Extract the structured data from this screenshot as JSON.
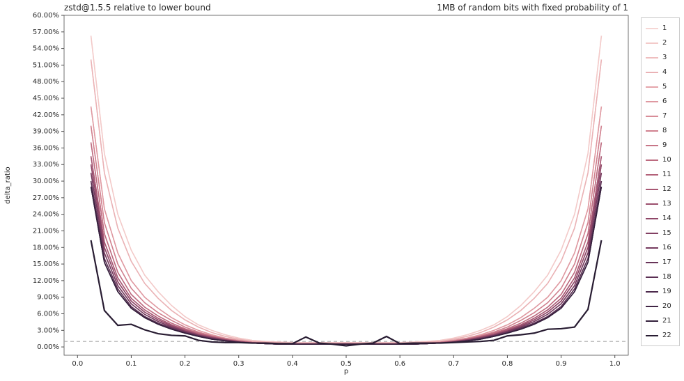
{
  "chart_data": {
    "type": "line",
    "title_left": "zstd@1.5.5 relative to lower bound",
    "title_right": "1MB of random bits with fixed probability of 1",
    "xlabel": "p",
    "ylabel": "delta_ratio",
    "xlim": [
      -0.025,
      1.025
    ],
    "ylim": [
      -1.5,
      60.0
    ],
    "xticks": [
      0.0,
      0.1,
      0.2,
      0.3,
      0.4,
      0.5,
      0.6,
      0.7,
      0.8,
      0.9,
      1.0
    ],
    "xticklabels": [
      "0.0",
      "0.1",
      "0.2",
      "0.3",
      "0.4",
      "0.5",
      "0.6",
      "0.7",
      "0.8",
      "0.9",
      "1.0"
    ],
    "yticks": [
      0,
      3,
      6,
      9,
      12,
      15,
      18,
      21,
      24,
      27,
      30,
      33,
      36,
      39,
      42,
      45,
      48,
      51,
      54,
      57,
      60
    ],
    "yticklabels": [
      "0.00%",
      "3.00%",
      "6.00%",
      "9.00%",
      "12.00%",
      "15.00%",
      "18.00%",
      "21.00%",
      "24.00%",
      "27.00%",
      "30.00%",
      "33.00%",
      "36.00%",
      "39.00%",
      "42.00%",
      "45.00%",
      "48.00%",
      "51.00%",
      "54.00%",
      "57.00%",
      "60.00%"
    ],
    "baseline_y": 1.0,
    "x": [
      0.025,
      0.05,
      0.075,
      0.1,
      0.125,
      0.15,
      0.175,
      0.2,
      0.225,
      0.25,
      0.275,
      0.3,
      0.325,
      0.35,
      0.375,
      0.4,
      0.425,
      0.45,
      0.475,
      0.5,
      0.525,
      0.55,
      0.575,
      0.6,
      0.625,
      0.65,
      0.675,
      0.7,
      0.725,
      0.75,
      0.775,
      0.8,
      0.825,
      0.85,
      0.875,
      0.9,
      0.925,
      0.95,
      0.975
    ],
    "legend_labels": [
      "1",
      "2",
      "3",
      "4",
      "5",
      "6",
      "7",
      "8",
      "9",
      "10",
      "11",
      "12",
      "13",
      "14",
      "15",
      "16",
      "17",
      "18",
      "19",
      "20",
      "21",
      "22"
    ],
    "colors": [
      "#f6d6d4",
      "#f3cac9",
      "#efbebf",
      "#eab2b5",
      "#e5a5ab",
      "#df99a1",
      "#d88d98",
      "#d0818f",
      "#c77687",
      "#bd6b80",
      "#b36179",
      "#a75773",
      "#9b4f6d",
      "#8f4768",
      "#824063",
      "#753a5e",
      "#683459",
      "#5a2f53",
      "#4d2a4d",
      "#402545",
      "#34203c",
      "#281c32"
    ],
    "series": [
      {
        "name": "1",
        "values": [
          56.3,
          35.0,
          24.0,
          17.5,
          13.0,
          10.0,
          7.5,
          5.5,
          4.0,
          3.0,
          2.2,
          1.6,
          1.2,
          1.0,
          0.9,
          0.8,
          0.8,
          0.8,
          0.8,
          0.8,
          0.8,
          0.8,
          0.8,
          0.8,
          0.9,
          1.0,
          1.2,
          1.6,
          2.2,
          3.0,
          4.0,
          5.5,
          7.5,
          10.0,
          13.0,
          17.5,
          24.0,
          35.0,
          56.3
        ]
      },
      {
        "name": "2",
        "values": [
          56.3,
          35.0,
          24.0,
          17.5,
          13.0,
          10.0,
          7.5,
          5.5,
          4.0,
          3.0,
          2.2,
          1.6,
          1.2,
          1.0,
          0.9,
          0.8,
          0.8,
          0.8,
          0.8,
          0.8,
          0.8,
          0.8,
          0.8,
          0.8,
          0.9,
          1.0,
          1.2,
          1.6,
          2.2,
          3.0,
          4.0,
          5.5,
          7.5,
          10.0,
          13.0,
          17.5,
          24.0,
          35.0,
          56.3
        ]
      },
      {
        "name": "3",
        "values": [
          52.0,
          31.5,
          21.5,
          15.5,
          11.5,
          8.8,
          6.6,
          4.9,
          3.6,
          2.6,
          1.9,
          1.4,
          1.0,
          0.9,
          0.8,
          0.7,
          0.7,
          0.7,
          0.7,
          0.7,
          0.7,
          0.7,
          0.7,
          0.7,
          0.8,
          0.9,
          1.0,
          1.4,
          1.9,
          2.6,
          3.6,
          4.9,
          6.6,
          8.8,
          11.5,
          15.5,
          21.5,
          31.5,
          52.0
        ]
      },
      {
        "name": "4",
        "values": [
          52.0,
          31.5,
          21.5,
          15.5,
          11.5,
          8.8,
          6.6,
          4.9,
          3.6,
          2.6,
          1.9,
          1.4,
          1.0,
          0.9,
          0.8,
          0.7,
          0.7,
          0.7,
          0.7,
          0.7,
          0.7,
          0.7,
          0.7,
          0.7,
          0.8,
          0.9,
          1.0,
          1.4,
          1.9,
          2.6,
          3.6,
          4.9,
          6.6,
          8.8,
          11.5,
          15.5,
          21.5,
          31.5,
          52.0
        ]
      },
      {
        "name": "5",
        "values": [
          43.5,
          25.0,
          17.0,
          12.0,
          9.0,
          7.0,
          5.3,
          4.0,
          3.0,
          2.2,
          1.6,
          1.2,
          0.9,
          0.8,
          0.7,
          0.6,
          0.6,
          0.6,
          0.6,
          0.6,
          0.6,
          0.6,
          0.6,
          0.6,
          0.7,
          0.8,
          0.9,
          1.2,
          1.6,
          2.2,
          3.0,
          4.0,
          5.3,
          7.0,
          9.0,
          12.0,
          17.0,
          25.0,
          43.5
        ]
      },
      {
        "name": "6",
        "values": [
          43.5,
          25.0,
          17.0,
          12.0,
          9.0,
          7.0,
          5.3,
          4.0,
          3.0,
          2.2,
          1.6,
          1.2,
          0.9,
          0.8,
          0.7,
          0.6,
          0.6,
          0.6,
          0.6,
          0.6,
          0.6,
          0.6,
          0.6,
          0.6,
          0.7,
          0.8,
          0.9,
          1.2,
          1.6,
          2.2,
          3.0,
          4.0,
          5.3,
          7.0,
          9.0,
          12.0,
          17.0,
          25.0,
          43.5
        ]
      },
      {
        "name": "7",
        "values": [
          40.0,
          22.5,
          15.0,
          10.6,
          8.0,
          6.2,
          4.8,
          3.6,
          2.7,
          2.0,
          1.5,
          1.1,
          0.8,
          0.7,
          0.6,
          0.6,
          0.6,
          0.6,
          0.6,
          0.6,
          0.6,
          0.6,
          0.6,
          0.6,
          0.6,
          0.7,
          0.8,
          1.1,
          1.5,
          2.0,
          2.7,
          3.6,
          4.8,
          6.2,
          8.0,
          10.6,
          15.0,
          22.5,
          40.0
        ]
      },
      {
        "name": "8",
        "values": [
          40.0,
          22.5,
          15.0,
          10.6,
          8.0,
          6.2,
          4.8,
          3.6,
          2.7,
          2.0,
          1.5,
          1.1,
          0.8,
          0.7,
          0.6,
          0.6,
          0.6,
          0.6,
          0.6,
          0.6,
          0.6,
          0.6,
          0.6,
          0.6,
          0.6,
          0.7,
          0.8,
          1.1,
          1.5,
          2.0,
          2.7,
          3.6,
          4.8,
          6.2,
          8.0,
          10.6,
          15.0,
          22.5,
          40.0
        ]
      },
      {
        "name": "9",
        "values": [
          37.0,
          20.5,
          13.5,
          9.5,
          7.2,
          5.6,
          4.3,
          3.3,
          2.5,
          1.9,
          1.4,
          1.0,
          0.8,
          0.7,
          0.6,
          0.6,
          0.6,
          0.6,
          0.6,
          0.6,
          0.6,
          0.6,
          0.6,
          0.6,
          0.6,
          0.7,
          0.8,
          1.0,
          1.4,
          1.9,
          2.5,
          3.3,
          4.3,
          5.6,
          7.2,
          9.5,
          13.5,
          20.5,
          37.0
        ]
      },
      {
        "name": "10",
        "values": [
          37.0,
          20.5,
          13.5,
          9.5,
          7.2,
          5.6,
          4.3,
          3.3,
          2.5,
          1.9,
          1.4,
          1.0,
          0.8,
          0.7,
          0.6,
          0.6,
          0.6,
          0.6,
          0.6,
          0.6,
          0.6,
          0.6,
          0.6,
          0.6,
          0.6,
          0.7,
          0.8,
          1.0,
          1.4,
          1.9,
          2.5,
          3.3,
          4.3,
          5.6,
          7.2,
          9.5,
          13.5,
          20.5,
          37.0
        ]
      },
      {
        "name": "11",
        "values": [
          34.5,
          19.0,
          12.5,
          8.8,
          6.7,
          5.2,
          4.0,
          3.1,
          2.3,
          1.8,
          1.3,
          1.0,
          0.8,
          0.6,
          0.6,
          0.5,
          0.5,
          0.5,
          0.5,
          0.5,
          0.5,
          0.5,
          0.5,
          0.5,
          0.6,
          0.6,
          0.8,
          1.0,
          1.3,
          1.8,
          2.3,
          3.1,
          4.0,
          5.2,
          6.7,
          8.8,
          12.5,
          19.0,
          34.5
        ]
      },
      {
        "name": "12",
        "values": [
          34.5,
          19.0,
          12.5,
          8.8,
          6.7,
          5.2,
          4.0,
          3.1,
          2.3,
          1.8,
          1.3,
          1.0,
          0.8,
          0.6,
          0.6,
          0.5,
          0.5,
          0.5,
          0.5,
          0.5,
          0.5,
          0.5,
          0.5,
          0.5,
          0.6,
          0.6,
          0.8,
          1.0,
          1.3,
          1.8,
          2.3,
          3.1,
          4.0,
          5.2,
          6.7,
          8.8,
          12.5,
          19.0,
          34.5
        ]
      },
      {
        "name": "13",
        "values": [
          33.0,
          18.0,
          11.8,
          8.3,
          6.3,
          4.9,
          3.8,
          2.9,
          2.2,
          1.7,
          1.3,
          0.9,
          0.7,
          0.6,
          0.6,
          0.5,
          0.5,
          0.5,
          0.5,
          0.5,
          0.5,
          0.5,
          0.5,
          0.5,
          0.6,
          0.6,
          0.7,
          0.9,
          1.3,
          1.7,
          2.2,
          2.9,
          3.8,
          4.9,
          6.3,
          8.3,
          11.8,
          18.0,
          33.0
        ]
      },
      {
        "name": "14",
        "values": [
          33.0,
          18.0,
          11.8,
          8.3,
          6.3,
          4.9,
          3.8,
          2.9,
          2.2,
          1.7,
          1.3,
          0.9,
          0.7,
          0.6,
          0.6,
          0.5,
          0.5,
          0.5,
          0.5,
          0.5,
          0.5,
          0.5,
          0.5,
          0.5,
          0.6,
          0.6,
          0.7,
          0.9,
          1.3,
          1.7,
          2.2,
          2.9,
          3.8,
          4.9,
          6.3,
          8.3,
          11.8,
          18.0,
          33.0
        ]
      },
      {
        "name": "15",
        "values": [
          31.5,
          17.0,
          11.1,
          7.8,
          5.9,
          4.6,
          3.6,
          2.8,
          2.1,
          1.6,
          1.2,
          0.9,
          0.7,
          0.6,
          0.5,
          0.5,
          0.5,
          0.5,
          0.5,
          0.5,
          0.5,
          0.5,
          0.5,
          0.5,
          0.5,
          0.6,
          0.7,
          0.9,
          1.2,
          1.6,
          2.1,
          2.8,
          3.6,
          4.6,
          5.9,
          7.8,
          11.1,
          17.0,
          31.5
        ]
      },
      {
        "name": "16",
        "values": [
          31.5,
          17.0,
          11.1,
          7.8,
          5.9,
          4.6,
          3.6,
          2.8,
          2.1,
          1.6,
          1.2,
          0.9,
          0.7,
          0.6,
          0.5,
          0.5,
          0.5,
          0.5,
          0.5,
          0.5,
          0.5,
          0.5,
          0.5,
          0.5,
          0.5,
          0.6,
          0.7,
          0.9,
          1.2,
          1.6,
          2.1,
          2.8,
          3.6,
          4.6,
          5.9,
          7.8,
          11.1,
          17.0,
          31.5
        ]
      },
      {
        "name": "17",
        "values": [
          30.0,
          16.0,
          10.5,
          7.3,
          5.5,
          4.3,
          3.4,
          2.6,
          2.0,
          1.5,
          1.1,
          0.9,
          0.7,
          0.6,
          0.5,
          0.5,
          0.5,
          0.5,
          0.5,
          0.5,
          0.5,
          0.5,
          0.5,
          0.5,
          0.5,
          0.6,
          0.7,
          0.9,
          1.1,
          1.5,
          2.0,
          2.6,
          3.4,
          4.3,
          5.5,
          7.3,
          10.5,
          16.0,
          30.0
        ]
      },
      {
        "name": "18",
        "values": [
          30.0,
          16.0,
          10.5,
          7.3,
          5.5,
          4.3,
          3.4,
          2.6,
          2.0,
          1.5,
          1.1,
          0.9,
          0.7,
          0.6,
          0.5,
          0.5,
          0.5,
          0.5,
          0.5,
          0.5,
          0.5,
          0.5,
          0.5,
          0.5,
          0.5,
          0.6,
          0.7,
          0.9,
          1.1,
          1.5,
          2.0,
          2.6,
          3.4,
          4.3,
          5.5,
          7.3,
          10.5,
          16.0,
          30.0
        ]
      },
      {
        "name": "19",
        "values": [
          29.0,
          15.3,
          10.0,
          7.0,
          5.3,
          4.1,
          3.2,
          2.5,
          1.9,
          1.4,
          1.1,
          0.8,
          0.7,
          0.6,
          0.5,
          0.5,
          0.5,
          0.5,
          0.5,
          0.5,
          0.5,
          0.5,
          0.5,
          0.5,
          0.5,
          0.6,
          0.7,
          0.8,
          1.1,
          1.4,
          1.9,
          2.5,
          3.2,
          4.1,
          5.3,
          7.0,
          10.0,
          15.3,
          29.0
        ]
      },
      {
        "name": "20",
        "values": [
          29.0,
          15.3,
          10.0,
          7.0,
          5.3,
          4.1,
          3.2,
          2.5,
          1.9,
          1.4,
          1.1,
          0.8,
          0.7,
          0.6,
          0.5,
          0.5,
          0.5,
          0.5,
          0.5,
          0.5,
          0.5,
          0.5,
          0.5,
          0.5,
          0.5,
          0.6,
          0.7,
          0.8,
          1.1,
          1.4,
          1.9,
          2.5,
          3.2,
          4.1,
          5.3,
          7.0,
          10.0,
          15.3,
          29.0
        ]
      },
      {
        "name": "21",
        "values": [
          29.0,
          15.3,
          10.0,
          7.0,
          5.3,
          4.1,
          3.2,
          2.5,
          1.9,
          1.4,
          1.1,
          0.8,
          0.7,
          0.6,
          0.5,
          0.5,
          0.5,
          0.5,
          0.5,
          0.5,
          0.5,
          0.5,
          0.5,
          0.5,
          0.5,
          0.6,
          0.7,
          0.8,
          1.1,
          1.4,
          1.9,
          2.5,
          3.2,
          4.1,
          5.3,
          7.0,
          10.0,
          15.3,
          29.0
        ]
      },
      {
        "name": "22",
        "values": [
          19.3,
          6.6,
          3.9,
          4.1,
          3.1,
          2.4,
          2.1,
          2.0,
          1.2,
          0.9,
          0.8,
          0.8,
          0.7,
          0.7,
          0.6,
          0.6,
          1.8,
          0.7,
          0.5,
          0.2,
          0.5,
          0.7,
          1.9,
          0.6,
          0.7,
          0.7,
          0.7,
          0.8,
          0.9,
          1.0,
          1.2,
          2.0,
          2.2,
          2.5,
          3.2,
          3.3,
          3.6,
          6.8,
          19.3
        ]
      }
    ]
  }
}
